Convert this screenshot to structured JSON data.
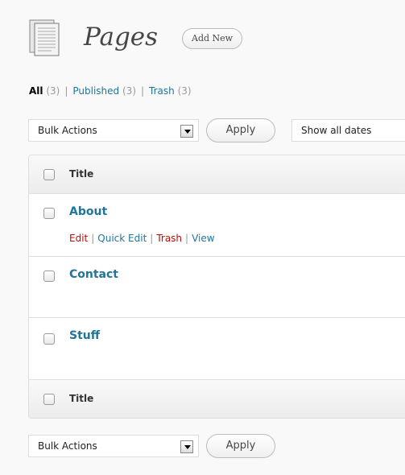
{
  "header": {
    "title": "Pages",
    "add_new_label": "Add New",
    "icon": "pages-icon"
  },
  "filters": {
    "all": {
      "label": "All",
      "count": "(3)"
    },
    "published": {
      "label": "Published",
      "count": "(3)"
    },
    "trash": {
      "label": "Trash",
      "count": "(3)"
    },
    "separator": "|"
  },
  "toolbar_top": {
    "bulk_actions": "Bulk Actions",
    "apply": "Apply",
    "dates": "Show all dates"
  },
  "table": {
    "column_title": "Title",
    "rows": [
      {
        "title": "About"
      },
      {
        "title": "Contact"
      },
      {
        "title": "Stuff"
      }
    ],
    "row_actions": {
      "edit": "Edit",
      "quick_edit": "Quick Edit",
      "trash": "Trash",
      "view": "View",
      "separator": "|"
    }
  },
  "toolbar_bottom": {
    "bulk_actions": "Bulk Actions",
    "apply": "Apply"
  },
  "colors": {
    "link": "#21759b",
    "trash": "#bc0b0b",
    "background": "#f9f9f9"
  }
}
